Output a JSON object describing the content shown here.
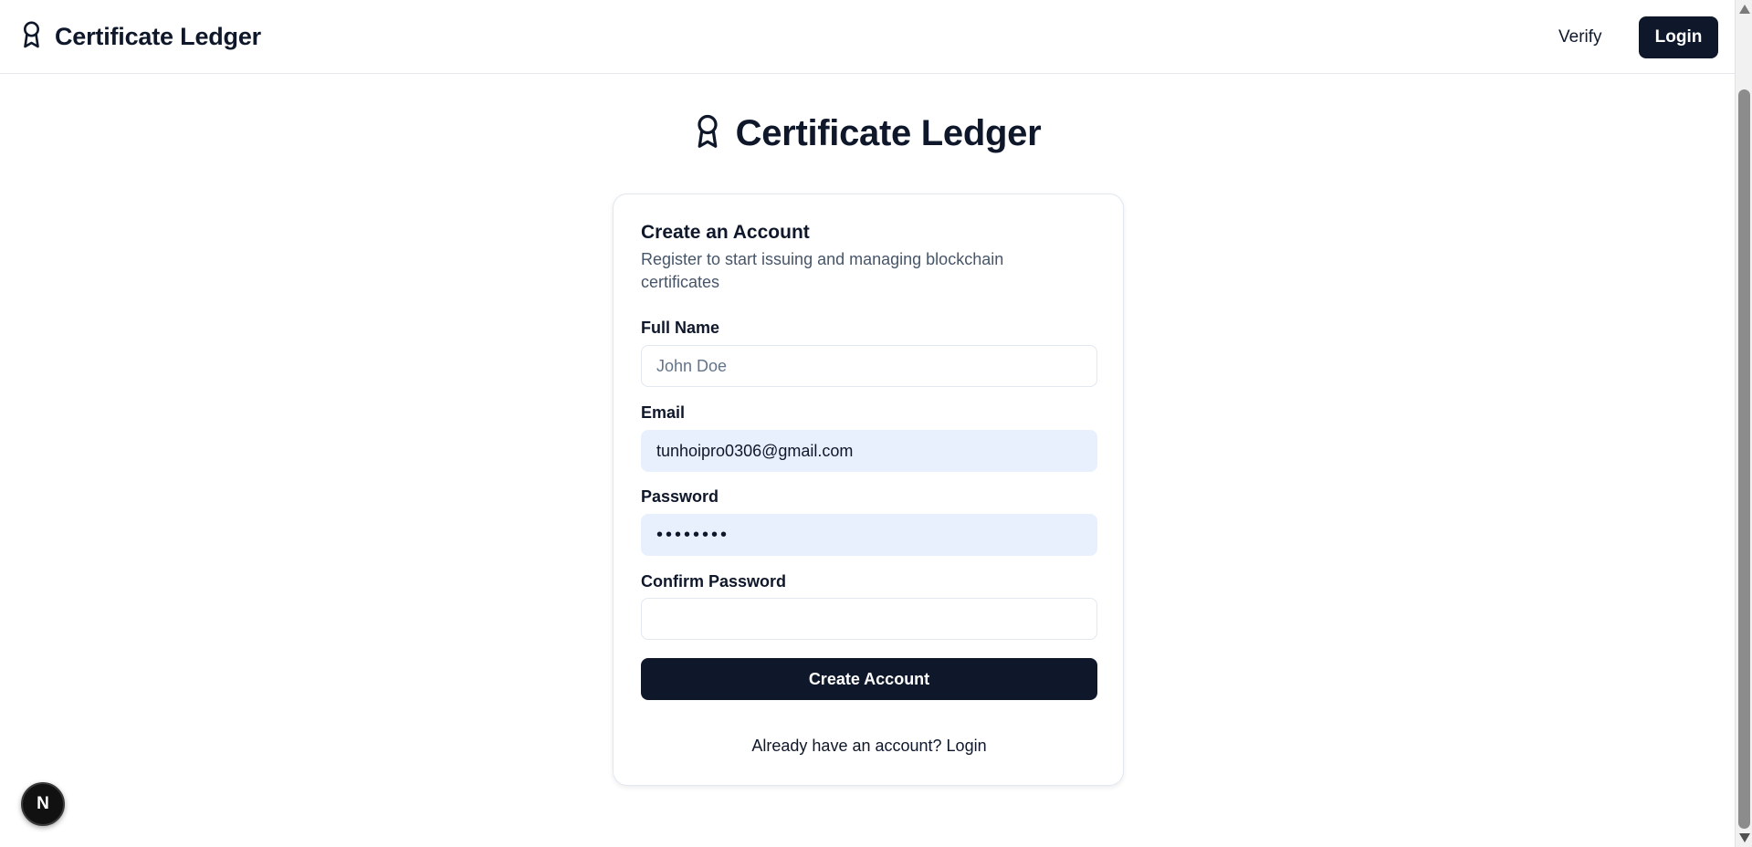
{
  "header": {
    "brand": "Certificate Ledger",
    "nav": {
      "verify": "Verify",
      "login": "Login"
    }
  },
  "page": {
    "title": "Certificate Ledger"
  },
  "form": {
    "title": "Create an Account",
    "description": "Register to start issuing and managing blockchain certificates",
    "fields": {
      "full_name": {
        "label": "Full Name",
        "placeholder": "John Doe",
        "value": ""
      },
      "email": {
        "label": "Email",
        "value": "tunhoipro0306@gmail.com"
      },
      "password": {
        "label": "Password",
        "value": "password"
      },
      "confirm_password": {
        "label": "Confirm Password",
        "value": ""
      }
    },
    "submit_label": "Create Account",
    "footer": {
      "prompt": "Already have an account? ",
      "login_link": "Login"
    }
  },
  "dev_badge": {
    "label": "N"
  },
  "icons": {
    "brand": "award-icon",
    "page_title": "award-icon"
  },
  "colors": {
    "primary": "#0f172a",
    "muted_text": "#475569",
    "autofill_bg": "#e8f0fe",
    "border": "#e2e8f0"
  }
}
